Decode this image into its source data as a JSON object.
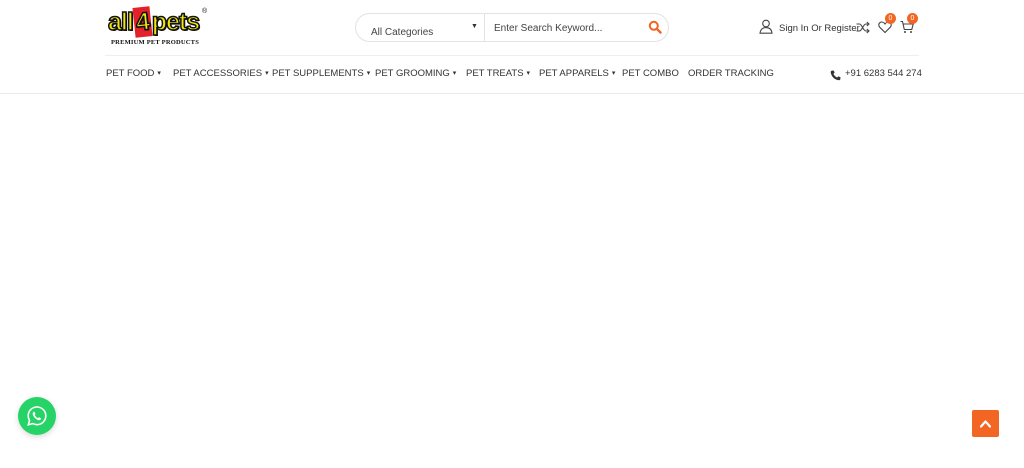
{
  "brand": {
    "logo_main_left": "all",
    "logo_four": "4",
    "logo_main_right": "pets",
    "logo_registered": "®",
    "tagline": "PREMIUM PET PRODUCTS",
    "logo_color": "#f2e60c",
    "logo_accent": "#e4202a"
  },
  "search": {
    "category_selected": "All Categories",
    "placeholder": "Enter Search Keyword...",
    "icon": "search-icon"
  },
  "account": {
    "label": "Sign In Or Register",
    "icon": "user-icon"
  },
  "counters": {
    "wishlist": "0",
    "cart": "0"
  },
  "nav": {
    "items": [
      {
        "label": "PET FOOD",
        "has_dropdown": true
      },
      {
        "label": "PET ACCESSORIES",
        "has_dropdown": true
      },
      {
        "label": "PET SUPPLEMENTS",
        "has_dropdown": true
      },
      {
        "label": "PET GROOMING",
        "has_dropdown": true
      },
      {
        "label": "PET TREATS",
        "has_dropdown": true
      },
      {
        "label": "PET APPARELS",
        "has_dropdown": true
      },
      {
        "label": "PET COMBO",
        "has_dropdown": false
      },
      {
        "label": "ORDER TRACKING",
        "has_dropdown": false
      }
    ],
    "caret": "▾",
    "phone": "+91 6283 544 274"
  },
  "colors": {
    "accent": "#f26522",
    "whatsapp": "#25d366"
  }
}
